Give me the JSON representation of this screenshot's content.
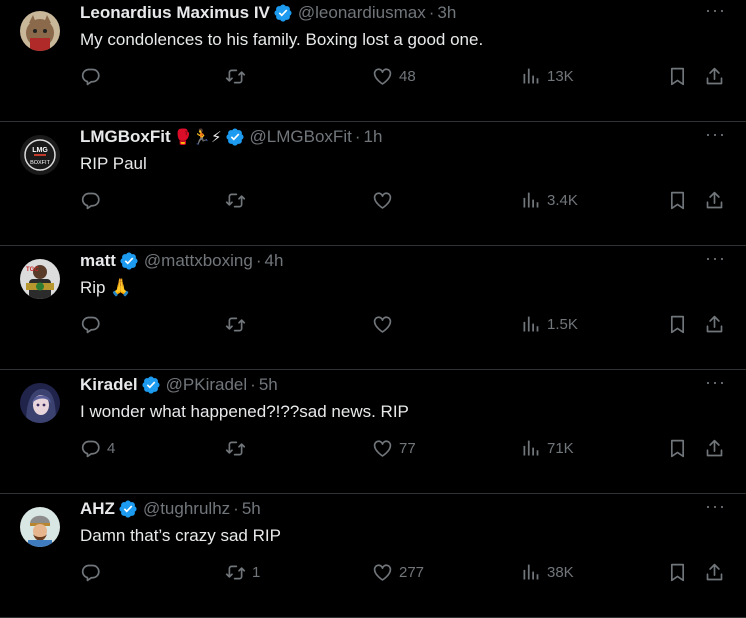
{
  "tweets": [
    {
      "name": "Leonardius Maximus IV",
      "name_emoji": "",
      "handle": "@leonardiusmax",
      "time": "3h",
      "text": "My condolences to his family. Boxing lost a good one.",
      "replies": "",
      "retweets": "",
      "likes": "48",
      "views": "13K",
      "avatar": "cat-avatar"
    },
    {
      "name": "LMGBoxFit",
      "name_emoji": "🥊🏃⚡",
      "handle": "@LMGBoxFit",
      "time": "1h",
      "text": "RIP Paul",
      "replies": "",
      "retweets": "",
      "likes": "",
      "views": "3.4K",
      "avatar": "lmg-logo-avatar"
    },
    {
      "name": "matt",
      "name_emoji": "",
      "handle": "@mattxboxing",
      "time": "4h",
      "text": "Rip 🙏",
      "replies": "",
      "retweets": "",
      "likes": "",
      "views": "1.5K",
      "avatar": "boxer-belt-avatar"
    },
    {
      "name": "Kiradel",
      "name_emoji": "",
      "handle": "@PKiradel",
      "time": "5h",
      "text": "I wonder what happened?!??sad news. RIP",
      "replies": "4",
      "retweets": "",
      "likes": "77",
      "views": "71K",
      "avatar": "anime-avatar"
    },
    {
      "name": "AHZ",
      "name_emoji": "",
      "handle": "@tughrulhz",
      "time": "5h",
      "text": "Damn that’s crazy sad RIP",
      "replies": "",
      "retweets": "1",
      "likes": "277",
      "views": "38K",
      "avatar": "warrior-avatar"
    }
  ],
  "more_label": "···",
  "colors": {
    "background": "#000000",
    "text": "#e7e9ea",
    "muted": "#71767b",
    "verified": "#1d9bf0",
    "divider": "#2f3336"
  }
}
